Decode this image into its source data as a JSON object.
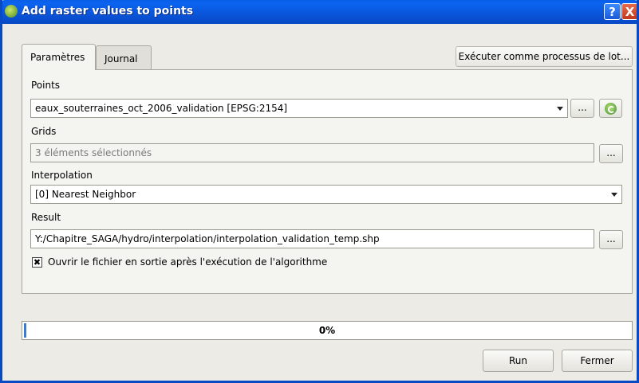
{
  "window": {
    "title": "Add raster values to points",
    "help_glyph": "?",
    "close_glyph": "X"
  },
  "tabs": [
    {
      "label": "Paramètres"
    },
    {
      "label": "Journal"
    }
  ],
  "batch_button": "Exécuter comme processus de lot...",
  "fields": {
    "points": {
      "label": "Points",
      "value": "eaux_souterraines_oct_2006_validation [EPSG:2154]"
    },
    "grids": {
      "label": "Grids",
      "value": "3 éléments sélectionnés"
    },
    "interpolation": {
      "label": "Interpolation",
      "value": "[0] Nearest Neighbor"
    },
    "result": {
      "label": "Result",
      "value": "Y:/Chapitre_SAGA/hydro/interpolation/interpolation_validation_temp.shp"
    }
  },
  "ellipsis": "...",
  "open_output": {
    "label": "Ouvrir le fichier en sortie après l'exécution de l'algorithme",
    "checked": true,
    "glyph": "✖"
  },
  "progress": {
    "percent_text": "0%",
    "fraction": 0.0
  },
  "buttons": {
    "run": "Run",
    "close": "Fermer"
  }
}
